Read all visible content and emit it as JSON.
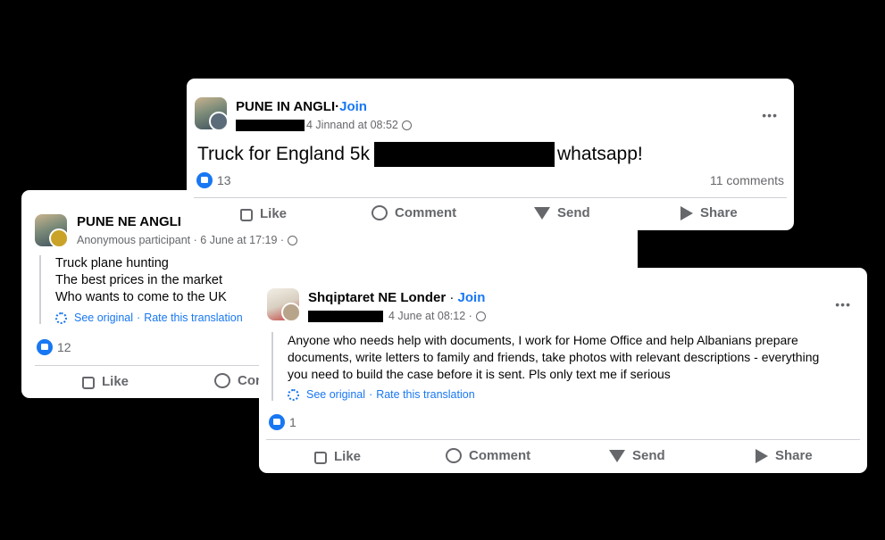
{
  "post_left": {
    "group_name": "PUNE NE ANGLI",
    "author": "Anonymous participant",
    "date": "6 June at 17:19",
    "lines": [
      "Truck plane hunting",
      "The best prices in the market",
      "Who wants to come to the UK"
    ],
    "see_original": "See original",
    "rate_translation": "Rate this translation",
    "reactions": "12",
    "like": "Like",
    "comment": "Con"
  },
  "post_top": {
    "group_name": "PUNE IN ANGLI",
    "join": "Join",
    "date": "4 Jinnand at 08:52",
    "text_before": "Truck for England 5k",
    "text_after": "whatsapp!",
    "reactions": "13",
    "comments": "11 comments",
    "like": "Like",
    "comment": "Comment",
    "send": "Send",
    "share": "Share",
    "more": "•••"
  },
  "post_right": {
    "group_name": "Shqiptaret NE Londer",
    "join": "Join",
    "date": "4 June at 08:12",
    "body": "Anyone who needs help with documents, I work for Home Office and help Albanians prepare documents, write letters to family and friends, take photos with relevant descriptions - everything you need to build the case before it is sent. Pls only text me if serious",
    "see_original": "See original",
    "rate_translation": "Rate this translation",
    "reactions": "1",
    "like": "Like",
    "comment": "Comment",
    "send": "Send",
    "share": "Share",
    "more": "•••"
  }
}
